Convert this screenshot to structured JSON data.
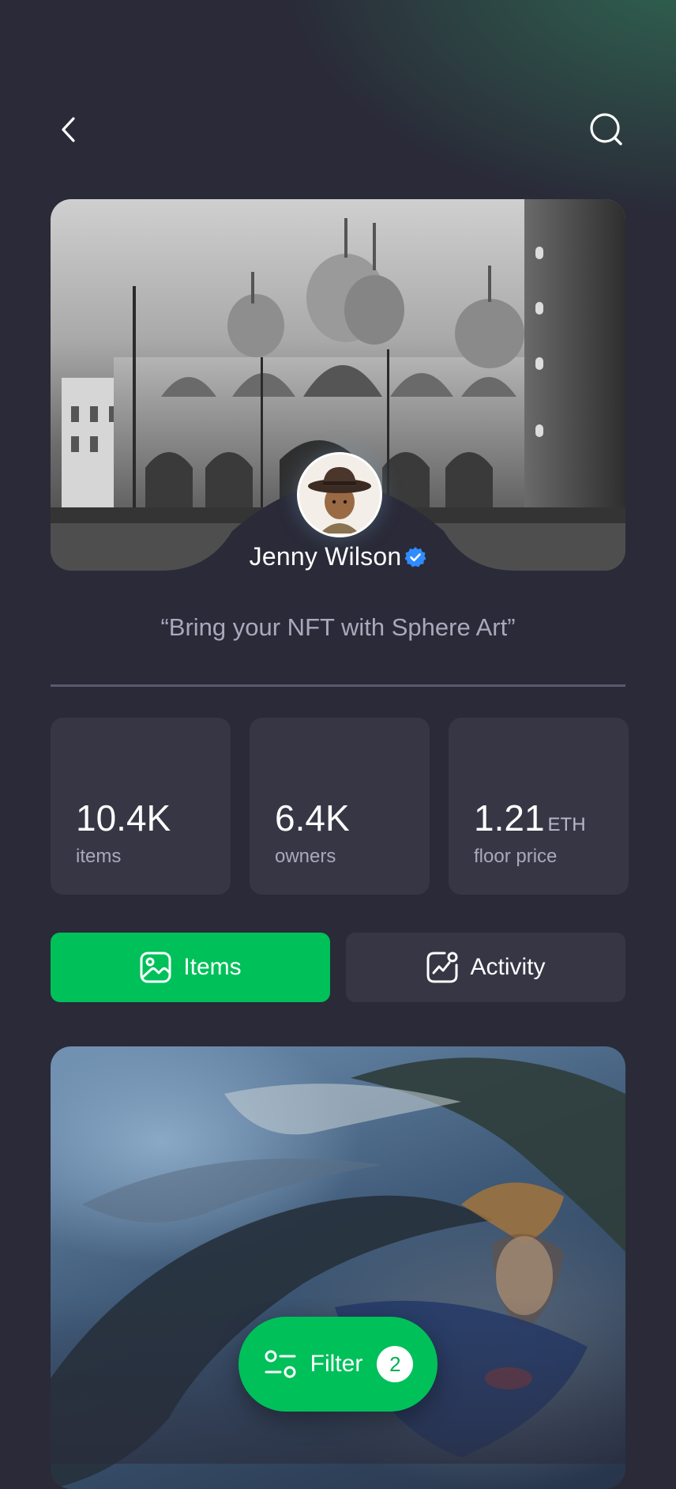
{
  "header": {
    "back_icon": "chevron-left-icon",
    "search_icon": "search-icon"
  },
  "profile": {
    "name": "Jenny Wilson",
    "verified": true,
    "bio": "“Bring your  NFT with Sphere Art”"
  },
  "stats": [
    {
      "value": "10.4K",
      "unit": "",
      "label": "items"
    },
    {
      "value": "6.4K",
      "unit": "",
      "label": "owners"
    },
    {
      "value": "1.21",
      "unit": "ETH",
      "label": "floor price"
    }
  ],
  "tabs": [
    {
      "label": "Items",
      "icon": "image-icon",
      "active": true
    },
    {
      "label": "Activity",
      "icon": "activity-chart-icon",
      "active": false
    }
  ],
  "filter": {
    "label": "Filter",
    "count": "2",
    "icon": "filter-sliders-icon"
  },
  "colors": {
    "background": "#2a2a38",
    "accent": "#00c05a",
    "card": "#363645",
    "verified_badge": "#2f8cff"
  }
}
